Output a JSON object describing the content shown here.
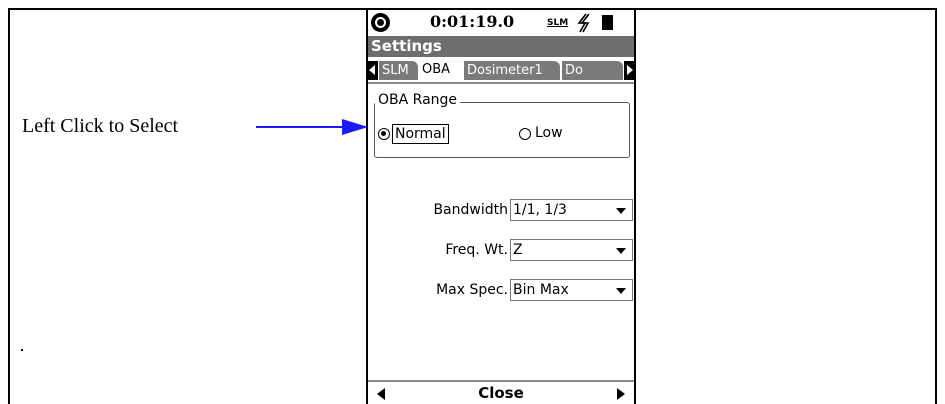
{
  "annotation": {
    "callout_text": "Left Click to Select"
  },
  "device": {
    "status": {
      "time": "0:01:19.0",
      "mode": "SLM",
      "icons": [
        "device-logo-icon",
        "power-bolt-icon",
        "battery-icon"
      ]
    },
    "title": "Settings",
    "tabs": [
      {
        "label": "SLM",
        "active": false
      },
      {
        "label": "OBA",
        "active": true
      },
      {
        "label": "Dosimeter1",
        "active": false
      },
      {
        "label": "Do",
        "active": false
      }
    ],
    "oba_range": {
      "legend": "OBA Range",
      "options": [
        {
          "label": "Normal",
          "selected": true
        },
        {
          "label": "Low",
          "selected": false
        }
      ]
    },
    "fields": [
      {
        "label": "Bandwidth",
        "value": "1/1, 1/3"
      },
      {
        "label": "Freq. Wt.",
        "value": "Z"
      },
      {
        "label": "Max Spec.",
        "value": "Bin Max"
      }
    ],
    "footer": {
      "close_label": "Close"
    }
  }
}
